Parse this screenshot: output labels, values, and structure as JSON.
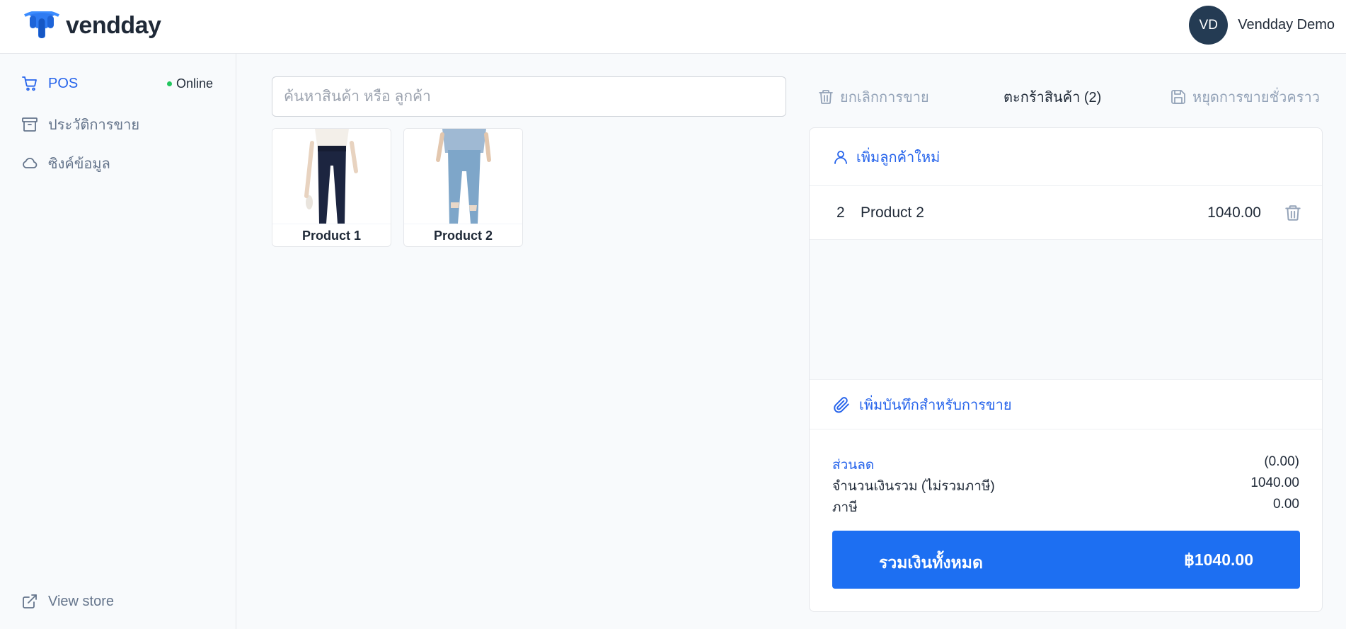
{
  "header": {
    "logo_text": "vendday",
    "avatar_initials": "VD",
    "user_name": "Vendday Demo"
  },
  "sidebar": {
    "items": [
      {
        "label": "POS",
        "icon": "cart-icon",
        "active": true
      },
      {
        "label": "ประวัติการขาย",
        "icon": "archive-icon",
        "active": false
      },
      {
        "label": "ซิงค์ข้อมูล",
        "icon": "cloud-icon",
        "active": false
      }
    ],
    "status": "Online",
    "view_store": "View store"
  },
  "search": {
    "placeholder": "ค้นหาสินค้า หรือ ลูกค้า"
  },
  "products": [
    {
      "name": "Product 1"
    },
    {
      "name": "Product 2"
    }
  ],
  "cart": {
    "cancel_label": "ยกเลิกการขาย",
    "title": "ตะกร้าสินค้า (2)",
    "park_label": "หยุดการขายชั่วคราว",
    "add_customer": "เพิ่มลูกค้าใหม่",
    "items": [
      {
        "qty": "2",
        "name": "Product 2",
        "price": "1040.00"
      }
    ],
    "add_note": "เพิ่มบันทึกสำหรับการขาย",
    "discount_label": "ส่วนลด",
    "discount_value": "(0.00)",
    "subtotal_label": "จำนวนเงินรวม (ไม่รวมภาษี)",
    "subtotal_value": "1040.00",
    "tax_label": "ภาษี",
    "tax_value": "0.00",
    "total_label": "รวมเงินทั้งหมด",
    "total_value": "฿1040.00"
  },
  "colors": {
    "accent": "#2563eb",
    "primary_button": "#1d6ff2",
    "avatar_bg": "#243b53",
    "online": "#22c55e"
  }
}
